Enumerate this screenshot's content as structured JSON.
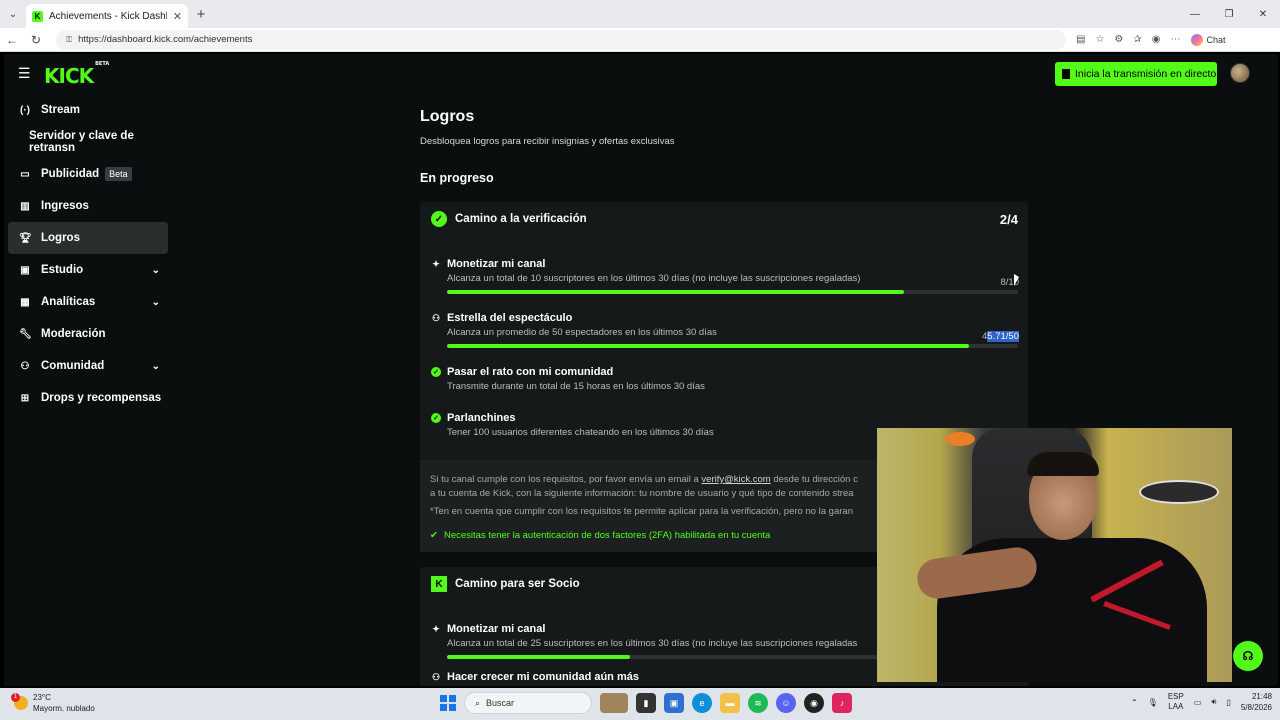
{
  "browser": {
    "tab_title": "Achievements - Kick Dashboard",
    "url": "https://dashboard.kick.com/achievements",
    "chat_label": "Chat"
  },
  "topnav": {
    "logo": "KICK",
    "logo_badge": "BETA",
    "go_live_label": "Inicia la transmisión en directo"
  },
  "sidebar": {
    "items": [
      {
        "label": "Stream"
      },
      {
        "label": "Servidor y clave de retransn"
      },
      {
        "label": "Publicidad",
        "badge": "Beta"
      },
      {
        "label": "Ingresos"
      },
      {
        "label": "Logros"
      },
      {
        "label": "Estudio"
      },
      {
        "label": "Analíticas"
      },
      {
        "label": "Moderación"
      },
      {
        "label": "Comunidad"
      },
      {
        "label": "Drops y recompensas"
      }
    ]
  },
  "main": {
    "title": "Logros",
    "subtitle": "Desbloquea logros para recibir insignias y ofertas exclusivas",
    "section": "En progreso",
    "card1": {
      "title": "Camino a la verificación",
      "count": "2/4",
      "reqs": [
        {
          "title": "Monetizar mi canal",
          "desc": "Alcanza un total de 10 suscriptores en los últimos 30 días (no incluye las suscripciones regaladas)",
          "value": "8/10",
          "progress": 0.8
        },
        {
          "title": "Estrella del espectáculo",
          "desc": "Alcanza un promedio de 50 espectadores en los últimos 30 días",
          "value_prefix": "4",
          "value_sel": "5.71/50",
          "progress": 0.914
        },
        {
          "title": "Pasar el rato con mi comunidad",
          "desc": "Transmite durante un total de 15 horas en los últimos 30 días"
        },
        {
          "title": "Parlanchines",
          "desc": "Tener 100 usuarios diferentes chateando en los últimos 30 días"
        }
      ],
      "note_pre": "Si tu canal cumple con los requisitos, por favor envía un email a ",
      "note_email": "verify@kick.com",
      "note_post": " desde tu dirección c",
      "note_line2": "a tu cuenta de Kick, con la siguiente información: tu nombre de usuario y qué tipo de contenido strea",
      "note_line3": "*Ten en cuenta que cumplir con los requisitos te permite aplicar para la verificación, pero no la garan",
      "note_ok": "Necesitas tener la autenticación de dos factores (2FA) habilitada en tu cuenta"
    },
    "card2": {
      "title": "Camino para ser Socio",
      "reqs": [
        {
          "title": "Monetizar mi canal",
          "desc": "Alcanza un total de 25 suscriptores en los últimos 30 días (no incluye las suscripciones regaladas",
          "progress": 0.32
        },
        {
          "title": "Hacer crecer mi comunidad aún más"
        }
      ]
    }
  },
  "taskbar": {
    "temp": "23°C",
    "weather": "Mayorm. nublado",
    "notif_count": "1",
    "search_placeholder": "Buscar",
    "lang1": "ESP",
    "lang2": "LAA",
    "time": "21:48",
    "date": "5/8/2026"
  },
  "colors": {
    "accent": "#53fc18",
    "bg": "#0b0e0f",
    "card": "#15191a"
  }
}
